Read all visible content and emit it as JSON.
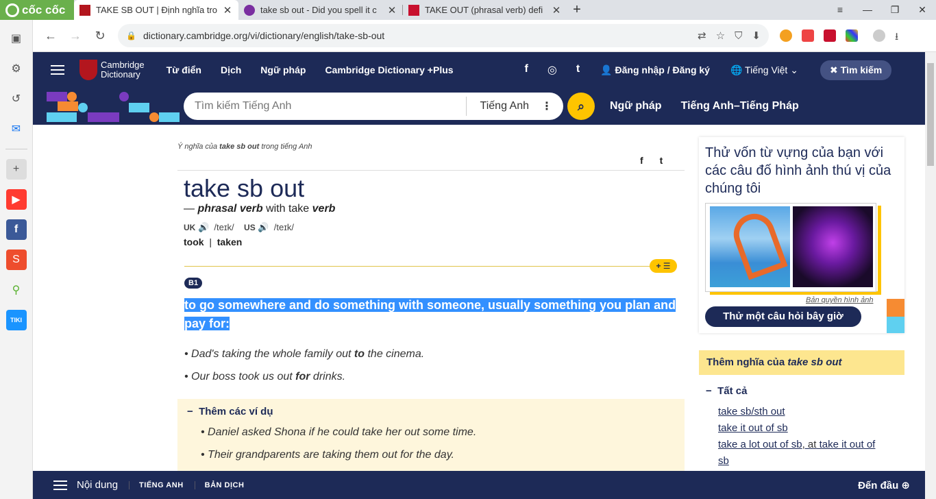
{
  "browser": {
    "logo": "cốc cốc",
    "tabs": [
      {
        "title": "TAKE SB OUT | Định nghĩa tro",
        "fav_color": "#b3161e"
      },
      {
        "title": "take sb out - Did you spell it c",
        "fav_color": "#7a2ea0"
      },
      {
        "title": "TAKE OUT (phrasal verb) defi",
        "fav_color": "#c8102e"
      }
    ],
    "url": "dictionary.cambridge.org/vi/dictionary/english/take-sb-out"
  },
  "header": {
    "logo_line1": "Cambridge",
    "logo_line2": "Dictionary",
    "nav": [
      "Từ điển",
      "Dịch",
      "Ngữ pháp",
      "Cambridge Dictionary +Plus"
    ],
    "social": [
      "f",
      "◎",
      "t"
    ],
    "login": "Đăng nhập / Đăng ký",
    "language": "Tiếng Việt",
    "search_toggle": "Tìm kiếm"
  },
  "search": {
    "placeholder": "Tìm kiếm Tiếng Anh",
    "dict": "Tiếng Anh",
    "links": [
      "Ngữ pháp",
      "Tiếng Anh–Tiếng Pháp"
    ]
  },
  "entry": {
    "meaning_prefix": "Ý nghĩa của",
    "meaning_word": "take sb out",
    "meaning_suffix": "trong tiếng Anh",
    "headword": "take sb out",
    "pos_dash": "—",
    "pos": "phrasal verb",
    "pos_with": "with take",
    "pos_verb": "verb",
    "uk": "UK",
    "uk_ipa": "/teɪk/",
    "us": "US",
    "us_ipa": "/teɪk/",
    "form1": "took",
    "form2": "taken",
    "level": "B1",
    "definition": "to go somewhere and do something with someone, usually something you plan and pay for:",
    "ex1_a": "Dad's taking the whole family out",
    "ex1_b": "to",
    "ex1_c": "the cinema.",
    "ex2_a": "Our boss took us out",
    "ex2_b": "for",
    "ex2_c": "drinks.",
    "more_title": "Thêm các ví dụ",
    "more_ex1": "Daniel asked Shona if he could take her out some time.",
    "more_ex2": "Their grandparents are taking them out for the day."
  },
  "quiz": {
    "title": "Thử vốn từ vựng của bạn với các câu đố hình ảnh thú vị của chúng tôi",
    "credit": "Bản quyền hình ảnh",
    "button": "Thử một câu hỏi bây giờ"
  },
  "more_meanings": {
    "title_prefix": "Thêm nghĩa của",
    "title_word": "take sb out",
    "all": "Tất cả",
    "link1": "take sb/sth out",
    "link2": "take it out of sb",
    "link3": "take a lot out of sb",
    "link3_sep": ", at",
    "link4": "take it out of",
    "link4b": "sb"
  },
  "bottom": {
    "contents": "Nội dung",
    "tab1": "TIẾNG ANH",
    "tab2": "BẢN DỊCH",
    "top": "Đến đầu"
  }
}
